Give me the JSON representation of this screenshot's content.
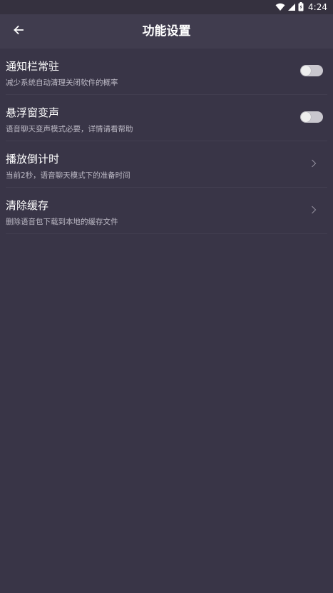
{
  "status_bar": {
    "time": "4:24",
    "icons": [
      "wifi-icon",
      "cellular-signal-icon",
      "battery-icon"
    ]
  },
  "app_bar": {
    "back_icon": "arrow-left-icon",
    "title": "功能设置"
  },
  "settings": [
    {
      "title": "通知栏常驻",
      "description": "减少系统自动清理关闭软件的概率",
      "control": "toggle",
      "enabled": false
    },
    {
      "title": "悬浮窗变声",
      "description": "语音聊天变声模式必要，详情请看帮助",
      "control": "toggle",
      "enabled": false
    },
    {
      "title": "播放倒计时",
      "description": "当前2秒，语音聊天模式下的准备时间",
      "control": "chevron-right-icon"
    },
    {
      "title": "清除缓存",
      "description": "删除语音包下载到本地的缓存文件",
      "control": "chevron-right-icon"
    }
  ],
  "colors": {
    "background": "#393547",
    "app_bar": "#403c4e",
    "status_bar": "#35313f",
    "divider": "#423e50",
    "toggle_off_track": "#c9c7ce",
    "description_text": "#bdbac6"
  }
}
